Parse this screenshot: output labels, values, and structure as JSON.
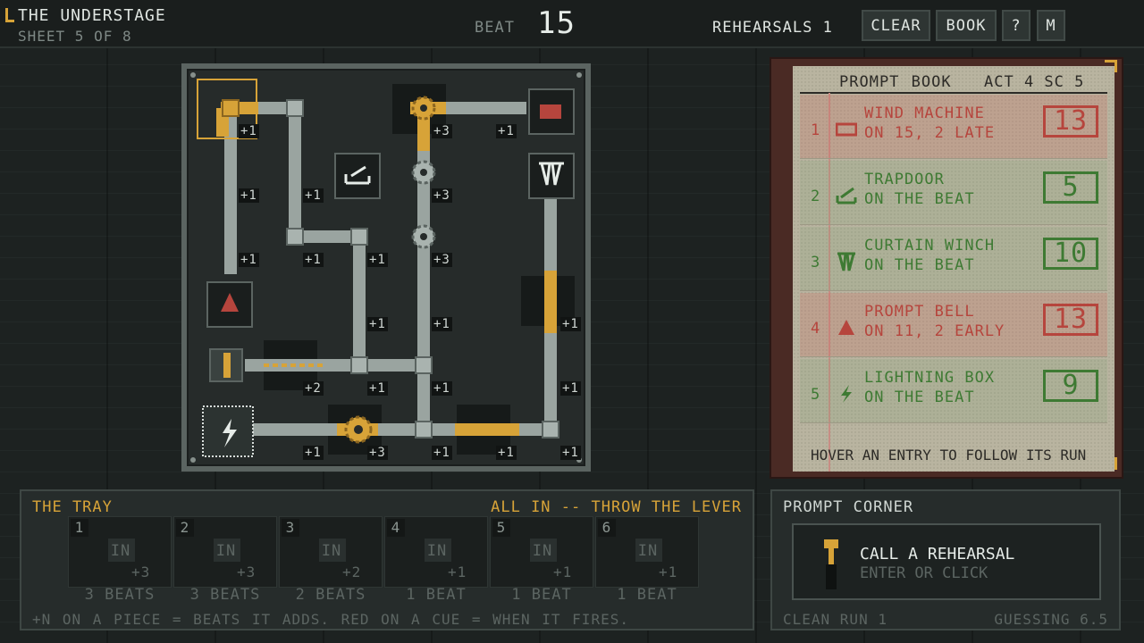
{
  "header": {
    "title": "THE UNDERSTAGE",
    "subtitle": "SHEET 5 OF 8",
    "beat_label": "BEAT",
    "beat_value": "15",
    "rehearsals": "REHEARSALS 1",
    "buttons": {
      "clear": "CLEAR",
      "book": "BOOK",
      "help": "?",
      "menu": "M"
    }
  },
  "board": {
    "tiles": [
      {
        "name": "tile-wind-machine",
        "icon": "wind-machine-icon"
      },
      {
        "name": "tile-trapdoor",
        "icon": "trapdoor-icon"
      },
      {
        "name": "tile-curtain-winch",
        "icon": "curtain-icon"
      },
      {
        "name": "tile-prompt-bell",
        "icon": "bell-icon"
      },
      {
        "name": "tile-lever",
        "icon": "lever-icon"
      },
      {
        "name": "tile-lightning-box",
        "icon": "lightning-icon"
      }
    ],
    "labels": [
      "+1",
      "+3",
      "+1",
      "+1",
      "+1",
      "+3",
      "+1",
      "+1",
      "+1",
      "+1",
      "+3",
      "+1",
      "+1",
      "+1",
      "+1",
      "+2",
      "+1",
      "+1",
      "+1",
      "+1",
      "+3",
      "+1",
      "+1",
      "+1"
    ]
  },
  "prompt_book": {
    "heading": "PROMPT BOOK",
    "act": "ACT 4 SC 5",
    "footer": "HOVER AN ENTRY TO FOLLOW ITS RUN",
    "entries": [
      {
        "num": "1",
        "line1": "WIND MACHINE",
        "line2": "ON 15, 2 LATE",
        "value": "13",
        "status": "bad",
        "icon": "wind-machine-icon"
      },
      {
        "num": "2",
        "line1": "TRAPDOOR",
        "line2": "ON THE BEAT",
        "value": "5",
        "status": "ok",
        "icon": "trapdoor-icon"
      },
      {
        "num": "3",
        "line1": "CURTAIN WINCH",
        "line2": "ON THE BEAT",
        "value": "10",
        "status": "ok",
        "icon": "curtain-icon"
      },
      {
        "num": "4",
        "line1": "PROMPT BELL",
        "line2": "ON 11, 2 EARLY",
        "value": "13",
        "status": "bad",
        "icon": "bell-icon"
      },
      {
        "num": "5",
        "line1": "LIGHTNING BOX",
        "line2": "ON THE BEAT",
        "value": "9",
        "status": "ok",
        "icon": "lightning-icon"
      }
    ]
  },
  "tray": {
    "title": "THE TRAY",
    "hint": "ALL IN -- THROW THE LEVER",
    "slots": [
      {
        "num": "1",
        "in": "IN",
        "plus": "+3",
        "beats": "3 BEATS"
      },
      {
        "num": "2",
        "in": "IN",
        "plus": "+3",
        "beats": "3 BEATS"
      },
      {
        "num": "3",
        "in": "IN",
        "plus": "+2",
        "beats": "2 BEATS"
      },
      {
        "num": "4",
        "in": "IN",
        "plus": "+1",
        "beats": "1 BEAT"
      },
      {
        "num": "5",
        "in": "IN",
        "plus": "+1",
        "beats": "1 BEAT"
      },
      {
        "num": "6",
        "in": "IN",
        "plus": "+1",
        "beats": "1 BEAT"
      }
    ],
    "footer": "+N ON A PIECE = BEATS IT ADDS.  RED ON A CUE = WHEN IT FIRES."
  },
  "corner": {
    "title": "PROMPT CORNER",
    "call": "CALL A REHEARSAL",
    "sub": "ENTER OR CLICK",
    "clean_run": "CLEAN RUN 1",
    "guessing": "GUESSING 6.5"
  },
  "colors": {
    "gold": "#d7a338",
    "steel": "#9aa4a0",
    "red": "#b6453d",
    "green": "#3e7a33"
  }
}
